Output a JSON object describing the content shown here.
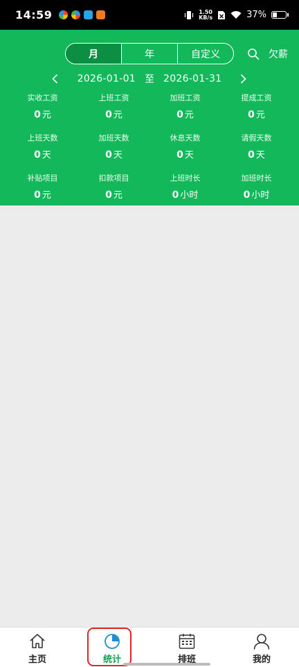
{
  "status": {
    "time": "14:59",
    "net_speed_value": "1.50",
    "net_speed_unit": "KB/s",
    "battery": "37%"
  },
  "header": {
    "period_tabs": [
      "月",
      "年",
      "自定义"
    ],
    "active_tab": "月",
    "owed_label": "欠薪",
    "date_start": "2026-01-01",
    "date_to": "至",
    "date_end": "2026-01-31"
  },
  "stats": [
    {
      "label": "实收工资",
      "value": "0",
      "unit": "元"
    },
    {
      "label": "上班工资",
      "value": "0",
      "unit": "元"
    },
    {
      "label": "加班工资",
      "value": "0",
      "unit": "元"
    },
    {
      "label": "提成工资",
      "value": "0",
      "unit": "元"
    },
    {
      "label": "上班天数",
      "value": "0",
      "unit": "天"
    },
    {
      "label": "加班天数",
      "value": "0",
      "unit": "天"
    },
    {
      "label": "休息天数",
      "value": "0",
      "unit": "天"
    },
    {
      "label": "请假天数",
      "value": "0",
      "unit": "天"
    },
    {
      "label": "补贴项目",
      "value": "0",
      "unit": "元"
    },
    {
      "label": "扣款项目",
      "value": "0",
      "unit": "元"
    },
    {
      "label": "上班时长",
      "value": "0",
      "unit": "小时"
    },
    {
      "label": "加班时长",
      "value": "0",
      "unit": "小时"
    }
  ],
  "tabbar": [
    {
      "label": "主页",
      "icon": "home-icon"
    },
    {
      "label": "统计",
      "icon": "pie-chart-icon"
    },
    {
      "label": "排班",
      "icon": "calendar-icon"
    },
    {
      "label": "我的",
      "icon": "person-icon"
    }
  ],
  "colors": {
    "brand_green": "#12b85a",
    "active_segment": "#0c8e43",
    "highlight_red": "#e02424"
  }
}
